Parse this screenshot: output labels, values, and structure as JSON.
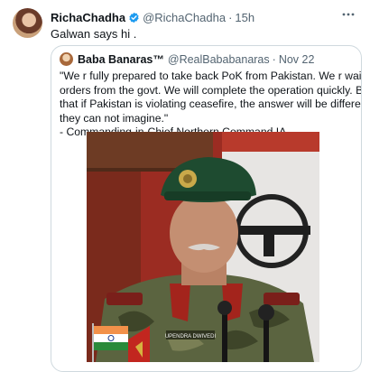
{
  "tweet": {
    "name": "RichaChadha",
    "handle": "@RichaChadha",
    "separator": "·",
    "time": "15h",
    "text": "Galwan says hi ."
  },
  "quote": {
    "name": "Baba Banaras™",
    "handle": "@RealBababanaras",
    "separator": "·",
    "time": "Nov 22",
    "lines": [
      "\"We r fully prepared to take back PoK from Pakistan. We r waiting the",
      "orders from the govt. We will complete the operation quickly. Before",
      "that if Pakistan is violating ceasefire, the answer will be different, even",
      "they can not imagine.\"",
      "- Commanding-in-Chief Northern Command IA"
    ],
    "photo": {
      "nametag": "UPENDRA DWIVEDI"
    }
  },
  "icons": {
    "verified": "verified-badge-icon",
    "more": "more-icon"
  },
  "colors": {
    "accent": "#1d9bf0",
    "secondary_text": "#536471",
    "border": "#cfd9de"
  }
}
